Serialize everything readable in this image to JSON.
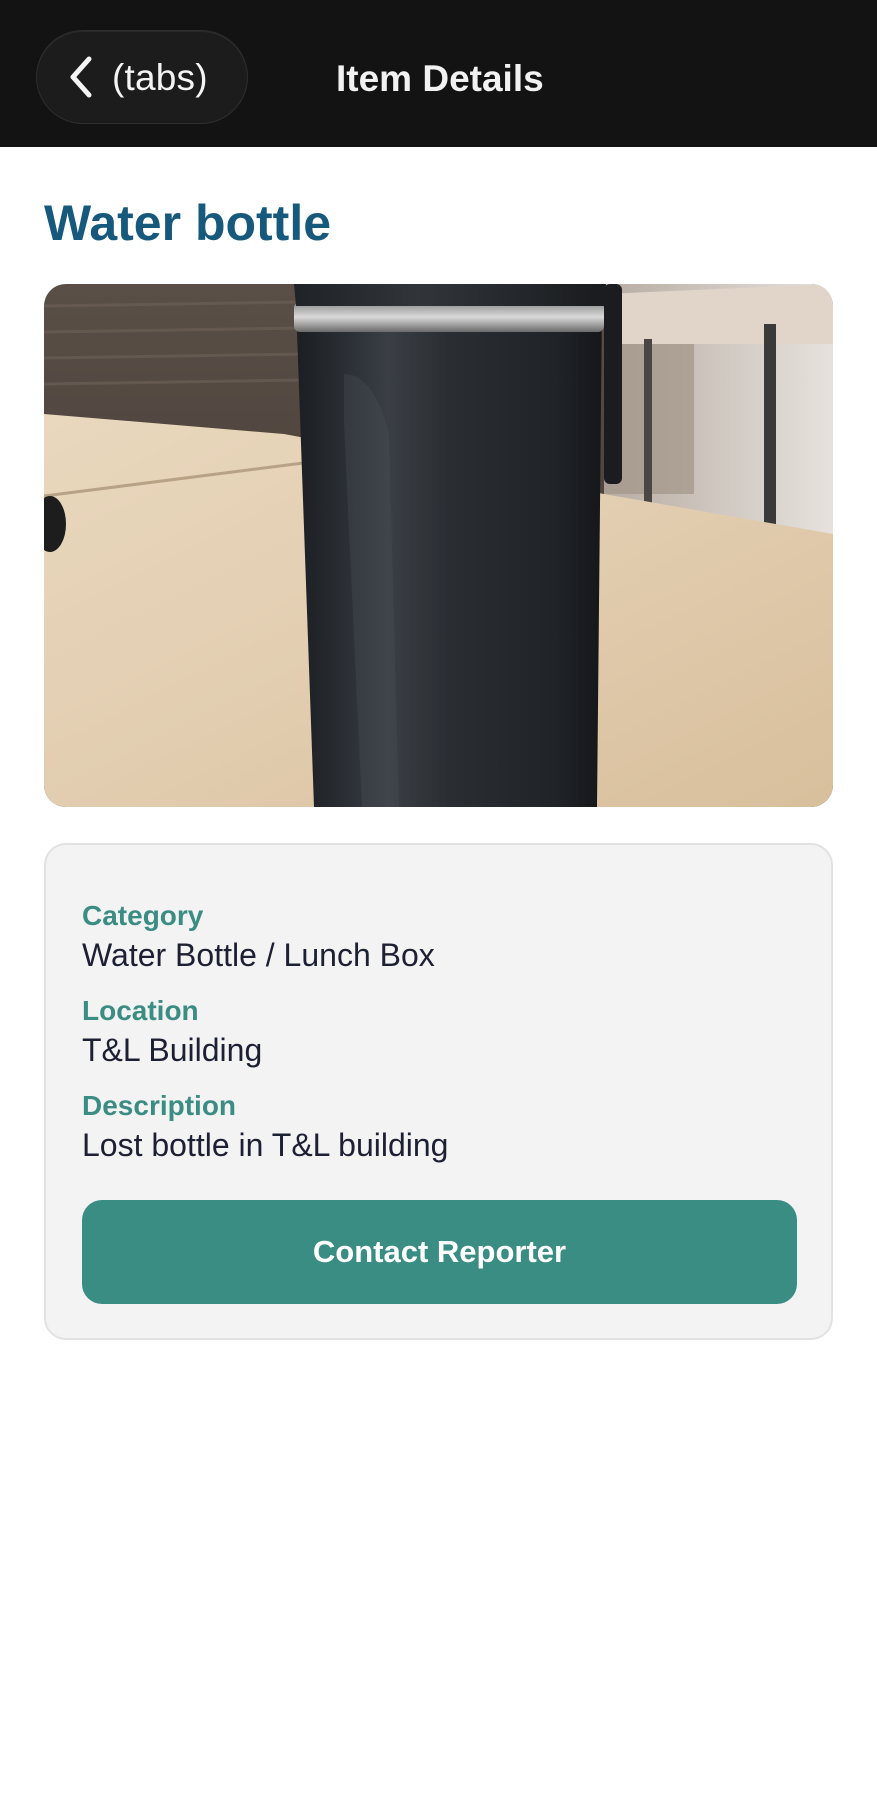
{
  "nav": {
    "back_label": "(tabs)",
    "back_icon": "chevron-left-icon",
    "title": "Item Details"
  },
  "item": {
    "title": "Water bottle",
    "photo_alt": "Water bottle"
  },
  "details": {
    "category_label": "Category",
    "category_value": "Water Bottle / Lunch Box",
    "location_label": "Location",
    "location_value": "T&L Building",
    "description_label": "Description",
    "description_value": "Lost bottle in T&L building"
  },
  "actions": {
    "contact_label": "Contact Reporter"
  },
  "colors": {
    "nav_background": "#131313",
    "title_blue": "#17597c",
    "label_teal": "#3b8c82",
    "button_teal": "#3a8d83",
    "card_background": "#f3f3f3"
  }
}
